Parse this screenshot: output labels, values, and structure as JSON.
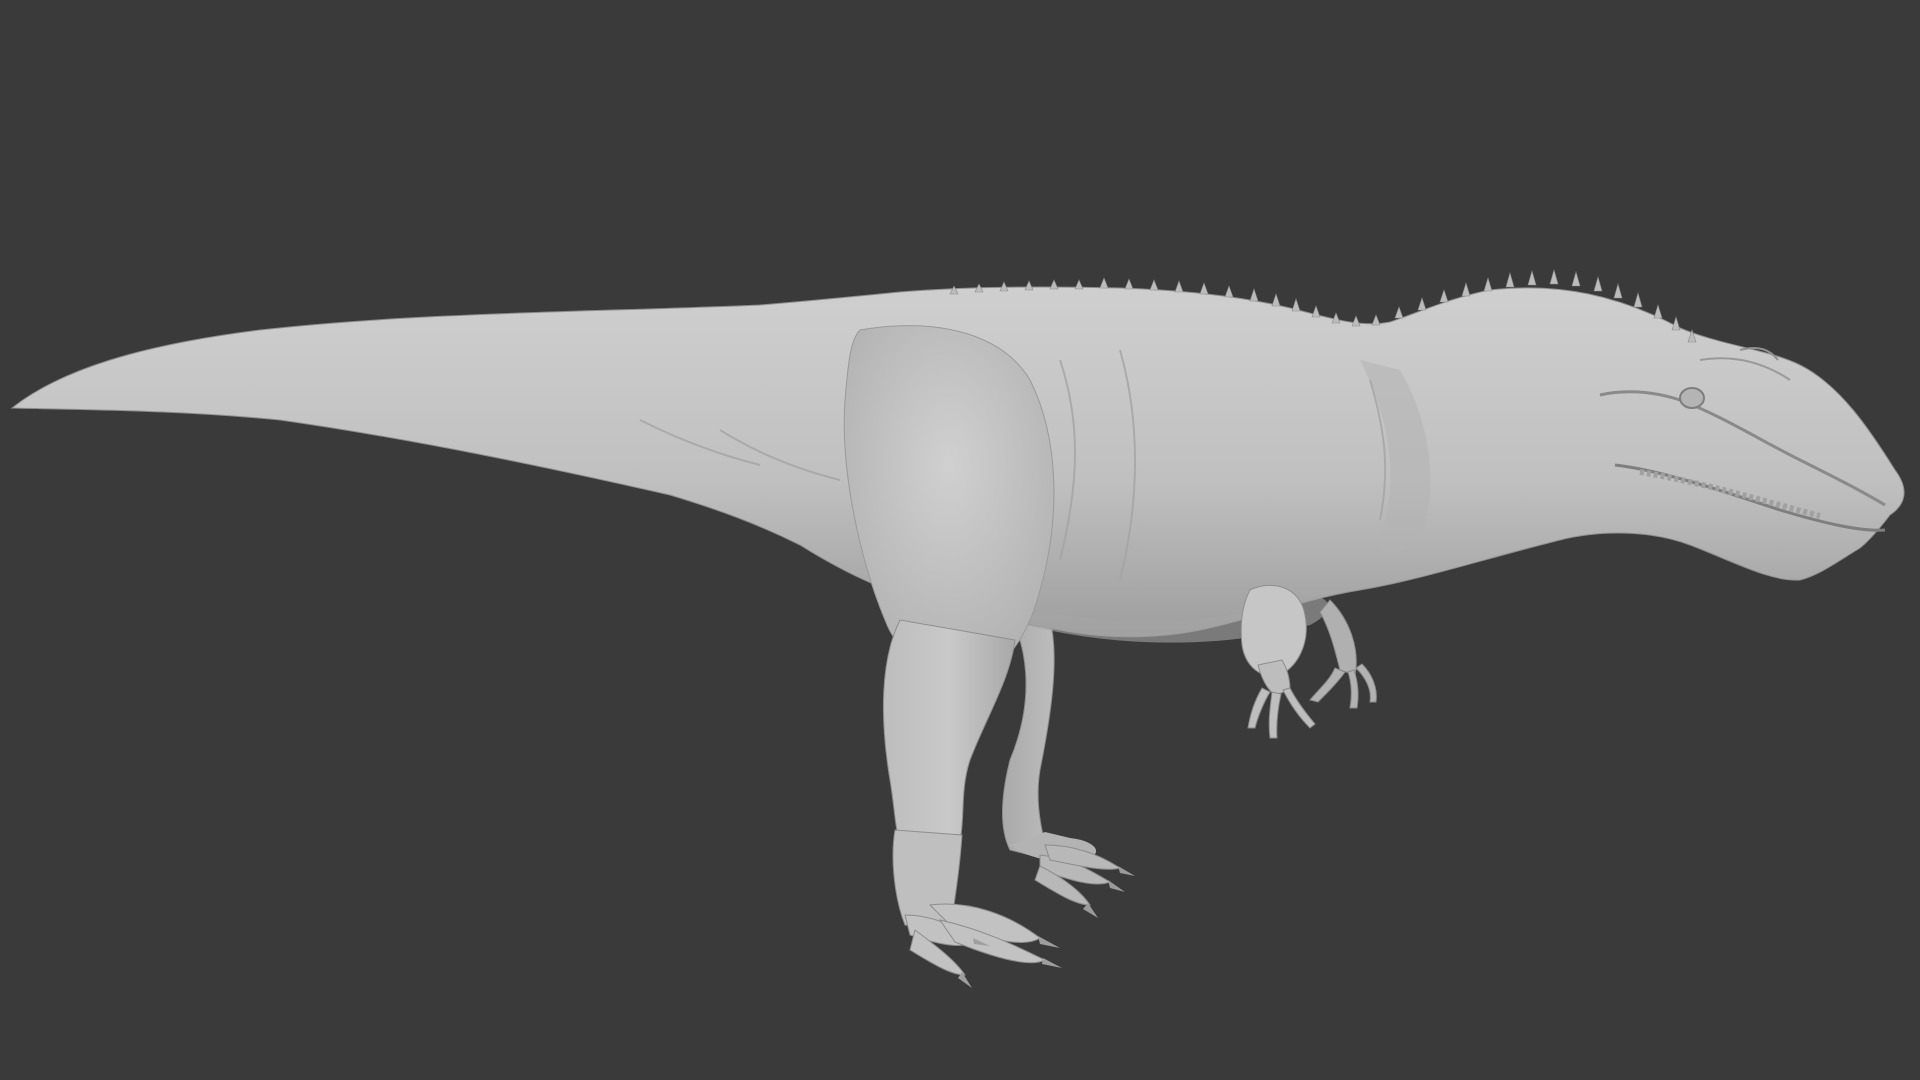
{
  "viewport": {
    "background_color": "#3a3a3a",
    "model_color": "#c2c2c2",
    "model_shadow_color": "#8a8a8a",
    "model_highlight_color": "#d4d4d4",
    "object": "clay-sculpt-theropod"
  }
}
